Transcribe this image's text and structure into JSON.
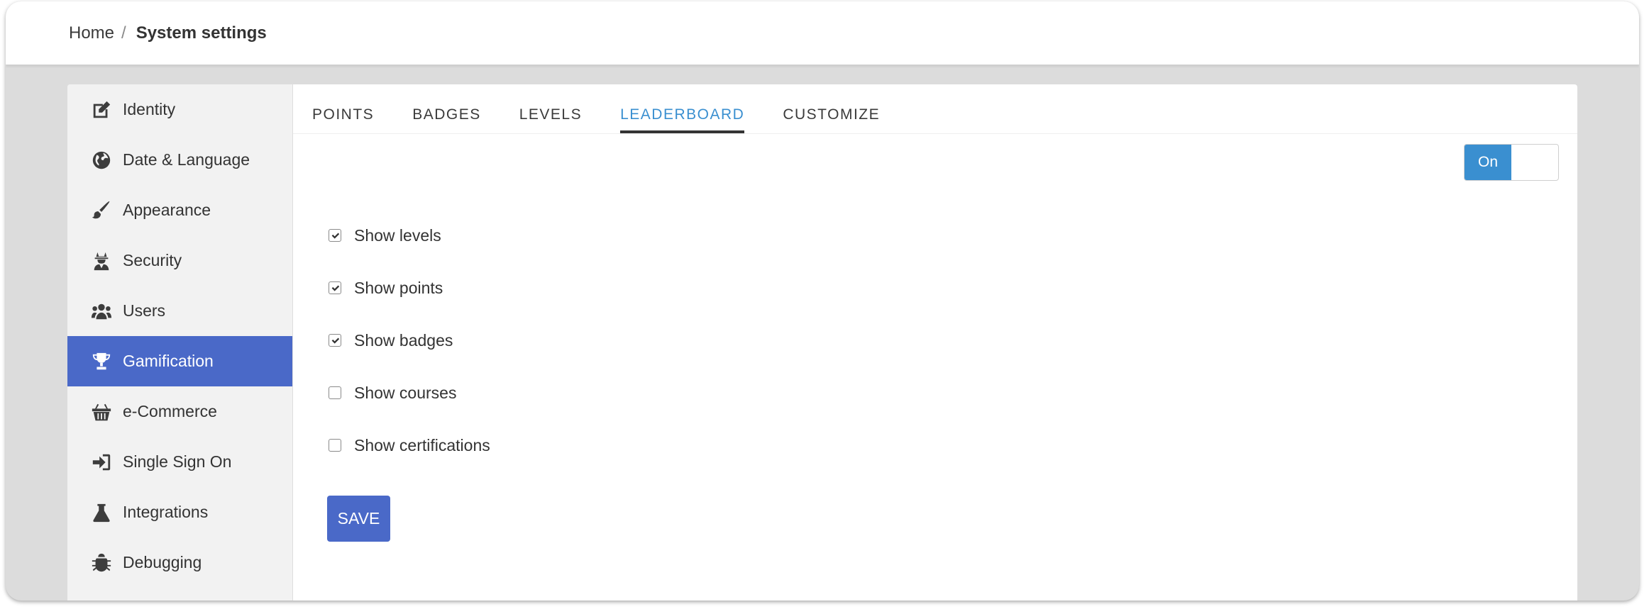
{
  "breadcrumb": {
    "home": "Home",
    "separator": "/",
    "current": "System settings"
  },
  "sidebar": {
    "items": [
      {
        "label": "Identity",
        "icon": "edit-icon",
        "active": false
      },
      {
        "label": "Date & Language",
        "icon": "globe-icon",
        "active": false
      },
      {
        "label": "Appearance",
        "icon": "paintbrush-icon",
        "active": false
      },
      {
        "label": "Security",
        "icon": "user-secret-icon",
        "active": false
      },
      {
        "label": "Users",
        "icon": "users-icon",
        "active": false
      },
      {
        "label": "Gamification",
        "icon": "trophy-icon",
        "active": true
      },
      {
        "label": "e-Commerce",
        "icon": "basket-icon",
        "active": false
      },
      {
        "label": "Single Sign On",
        "icon": "sign-in-icon",
        "active": false
      },
      {
        "label": "Integrations",
        "icon": "flask-icon",
        "active": false
      },
      {
        "label": "Debugging",
        "icon": "bug-icon",
        "active": false
      }
    ]
  },
  "tabs": [
    {
      "label": "POINTS",
      "active": false
    },
    {
      "label": "BADGES",
      "active": false
    },
    {
      "label": "LEVELS",
      "active": false
    },
    {
      "label": "LEADERBOARD",
      "active": true
    },
    {
      "label": "CUSTOMIZE",
      "active": false
    }
  ],
  "toggle": {
    "on_label": "On",
    "state": "on"
  },
  "options": [
    {
      "label": "Show levels",
      "checked": true
    },
    {
      "label": "Show points",
      "checked": true
    },
    {
      "label": "Show badges",
      "checked": true
    },
    {
      "label": "Show courses",
      "checked": false
    },
    {
      "label": "Show certifications",
      "checked": false
    }
  ],
  "save_label": "SAVE",
  "colors": {
    "accent": "#4a69c8",
    "tab_active": "#3a8fd0",
    "toggle_on": "#3a8fd0",
    "sidebar_bg": "#f2f2f2",
    "page_bg": "#dcdcdc"
  }
}
